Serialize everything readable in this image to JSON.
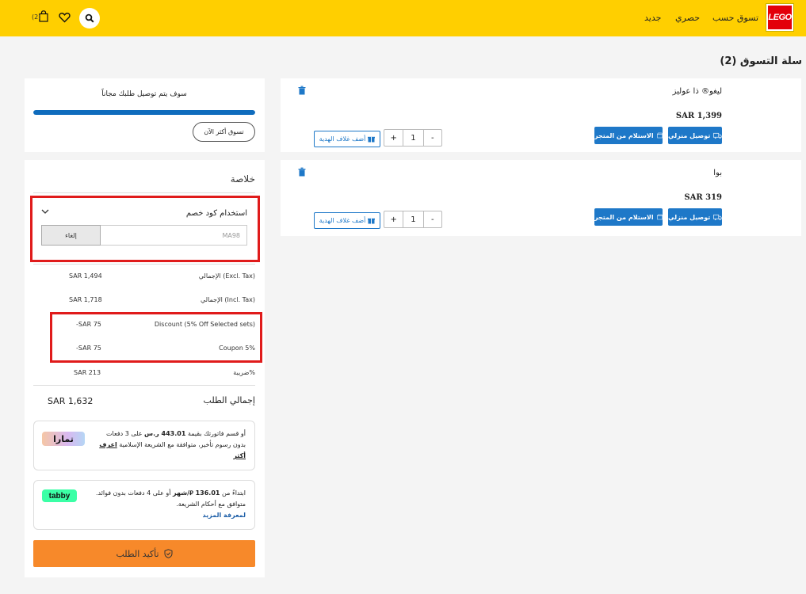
{
  "header": {
    "nav": {
      "shop_by": "تسوق حسب",
      "exclusive": "حصري",
      "new": "جديد"
    },
    "logo_text": "LEGO",
    "bag_count": "(2)",
    "brand_color": "#ffcf00"
  },
  "page_title": "سلة التسوق (2)",
  "cart_items": [
    {
      "name": "ليغو® ذا عوليز",
      "price": "SAR 1,399",
      "home_delivery": "توصيل منزلي",
      "store_pickup": "الاستلام من المتجر",
      "qty": "1",
      "minus": "-",
      "plus": "+",
      "gift_wrap": "أضف غلاف الهدية"
    },
    {
      "name": "بوا",
      "price": "SAR 319",
      "home_delivery": "توصيل منزلي",
      "store_pickup": "الاستلام من المتجر",
      "qty": "1",
      "minus": "-",
      "plus": "+",
      "gift_wrap": "أضف غلاف الهدية"
    }
  ],
  "shipping": {
    "text": "سوف يتم توصيل طلبك مجاناً",
    "progress": 1.0,
    "shop_more": "تسوق أكثر الآن"
  },
  "summary": {
    "title": "خلاصة",
    "coupon_label": "استخدام كود خصم",
    "coupon_value": "MA98",
    "cancel": "إلغاء",
    "rows": [
      {
        "label": "الإجمالي (Excl. Tax)",
        "value": "SAR 1,494"
      },
      {
        "label": "الإجمالي (Incl. Tax)",
        "value": "SAR 1,718"
      },
      {
        "label": "Discount (5% Off Selected sets)",
        "value": "-SAR 75"
      },
      {
        "label": "Coupon 5%",
        "value": "-SAR 75"
      },
      {
        "label": "ضريبة%",
        "value": "SAR 213"
      }
    ],
    "total_label": "إجمالي الطلب",
    "total_value": "SAR 1,632"
  },
  "tamara": {
    "logo": "تمارا",
    "line1_pre": "أو قسم فاتورتك بقيمة",
    "amount": "443.01 ر.س",
    "line1_post": "على 3 دفعات",
    "line2": "بدون رسوم تأخير، متوافقة مع الشريعة الإسلامية",
    "learn_more": "اعرف أكثر"
  },
  "tabby": {
    "logo": "tabby",
    "line1_pre": "ابتداءً من",
    "amount": "136.01 ⃁/شهر",
    "line1_post": "أو على 4 دفعات بدون فوائد.",
    "line2": "متوافق مع أحكام الشريعة.",
    "learn_more": "لمعرفة المزيد"
  },
  "confirm_button": "تأكيد الطلب",
  "colors": {
    "accent_blue": "#1e78c8",
    "confirm_orange": "#f7892a",
    "highlight_red": "#e01b1b"
  }
}
